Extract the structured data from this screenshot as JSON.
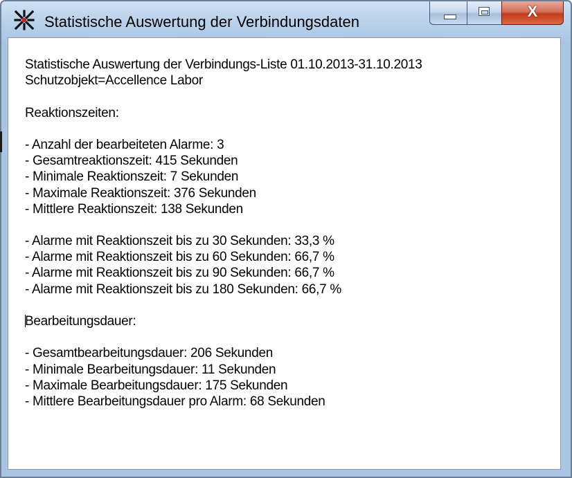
{
  "window": {
    "title": "Statistische Auswertung der Verbindungsdaten",
    "icon": "grid-star-app-icon",
    "controls": {
      "minimize_icon": "minimize-icon",
      "maximize_icon": "maximize-icon",
      "close_icon": "close-icon",
      "close_glyph": "X"
    }
  },
  "report": {
    "lines": [
      "Statistische Auswertung der Verbindungs-Liste 01.10.2013-31.10.2013",
      "Schutzobjekt=Accellence Labor",
      "",
      "Reaktionszeiten:",
      "",
      "- Anzahl der bearbeiteten Alarme: 3",
      "- Gesamtreaktionszeit: 415 Sekunden",
      "- Minimale Reaktionszeit: 7 Sekunden",
      "- Maximale Reaktionszeit: 376 Sekunden",
      "- Mittlere Reaktionszeit: 138 Sekunden",
      "",
      "- Alarme mit Reaktionszeit bis zu 30 Sekunden: 33,3 %",
      "- Alarme mit Reaktionszeit bis zu 60 Sekunden: 66,7 %",
      "- Alarme mit Reaktionszeit bis zu 90 Sekunden: 66,7 %",
      "- Alarme mit Reaktionszeit bis zu 180 Sekunden: 66,7 %",
      "",
      "Bearbeitungsdauer:",
      "",
      "- Gesamtbearbeitungsdauer: 206 Sekunden",
      "- Minimale Bearbeitungsdauer: 11 Sekunden",
      "- Maximale Bearbeitungsdauer: 175 Sekunden",
      "- Mittlere Bearbeitungsdauer pro Alarm: 68 Sekunden"
    ]
  },
  "colors": {
    "frame": "#aac5e3",
    "close_button": "#c43b1d",
    "text": "#000000"
  }
}
